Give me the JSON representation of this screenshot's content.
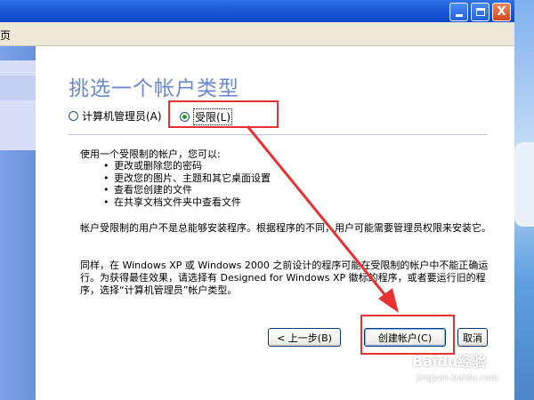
{
  "window": {
    "min_label": "",
    "max_label": "",
    "close_label": "X"
  },
  "menubar": {
    "home_label": "主页"
  },
  "wizard": {
    "title": "挑选一个帐户类型",
    "radios": [
      {
        "label": "计算机管理员(A)",
        "checked": false
      },
      {
        "label": "受限(L)",
        "checked": true
      }
    ],
    "intro": "使用一个受限制的帐户，您可以:",
    "bullets": [
      "更改或删除您的密码",
      "更改您的图片、主题和其它桌面设置",
      "查看您创建的文件",
      "在共享文档文件夹中查看文件"
    ],
    "para1": "帐户受限制的用户不是总能够安装程序。根据程序的不同，用户可能需要管理员权限来安装它。",
    "para2": "同样，在 Windows XP 或 Windows 2000 之前设计的程序可能在受限制的帐户中不能正确运行。为获得最佳效果，请选择有 Designed for Windows XP 徽标的程序，或者要运行旧的程序，选择“计算机管理员”帐户类型。",
    "buttons": {
      "back": "< 上一步(B)",
      "create": "创建帐户(C)",
      "cancel": "取消"
    }
  },
  "annotation_color": "#e63232",
  "watermark": {
    "brand": "Baidu经验",
    "url": "jingyan.baidu.com"
  }
}
